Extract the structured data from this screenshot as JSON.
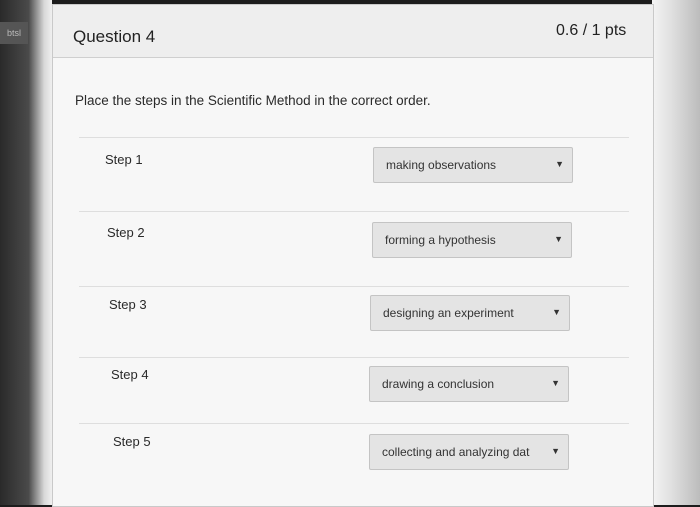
{
  "sidebar": {
    "tab_label": "btsl"
  },
  "question": {
    "title": "Question 4",
    "points": "0.6 / 1 pts",
    "prompt": "Place the steps in the Scientific Method in the correct order."
  },
  "steps": [
    {
      "label": "Step 1",
      "selected": "making observations"
    },
    {
      "label": "Step 2",
      "selected": "forming a hypothesis"
    },
    {
      "label": "Step 3",
      "selected": "designing an experiment"
    },
    {
      "label": "Step 4",
      "selected": "drawing a conclusion"
    },
    {
      "label": "Step 5",
      "selected": "collecting and analyzing dat"
    }
  ],
  "icons": {
    "dropdown": "caret-down-icon"
  }
}
